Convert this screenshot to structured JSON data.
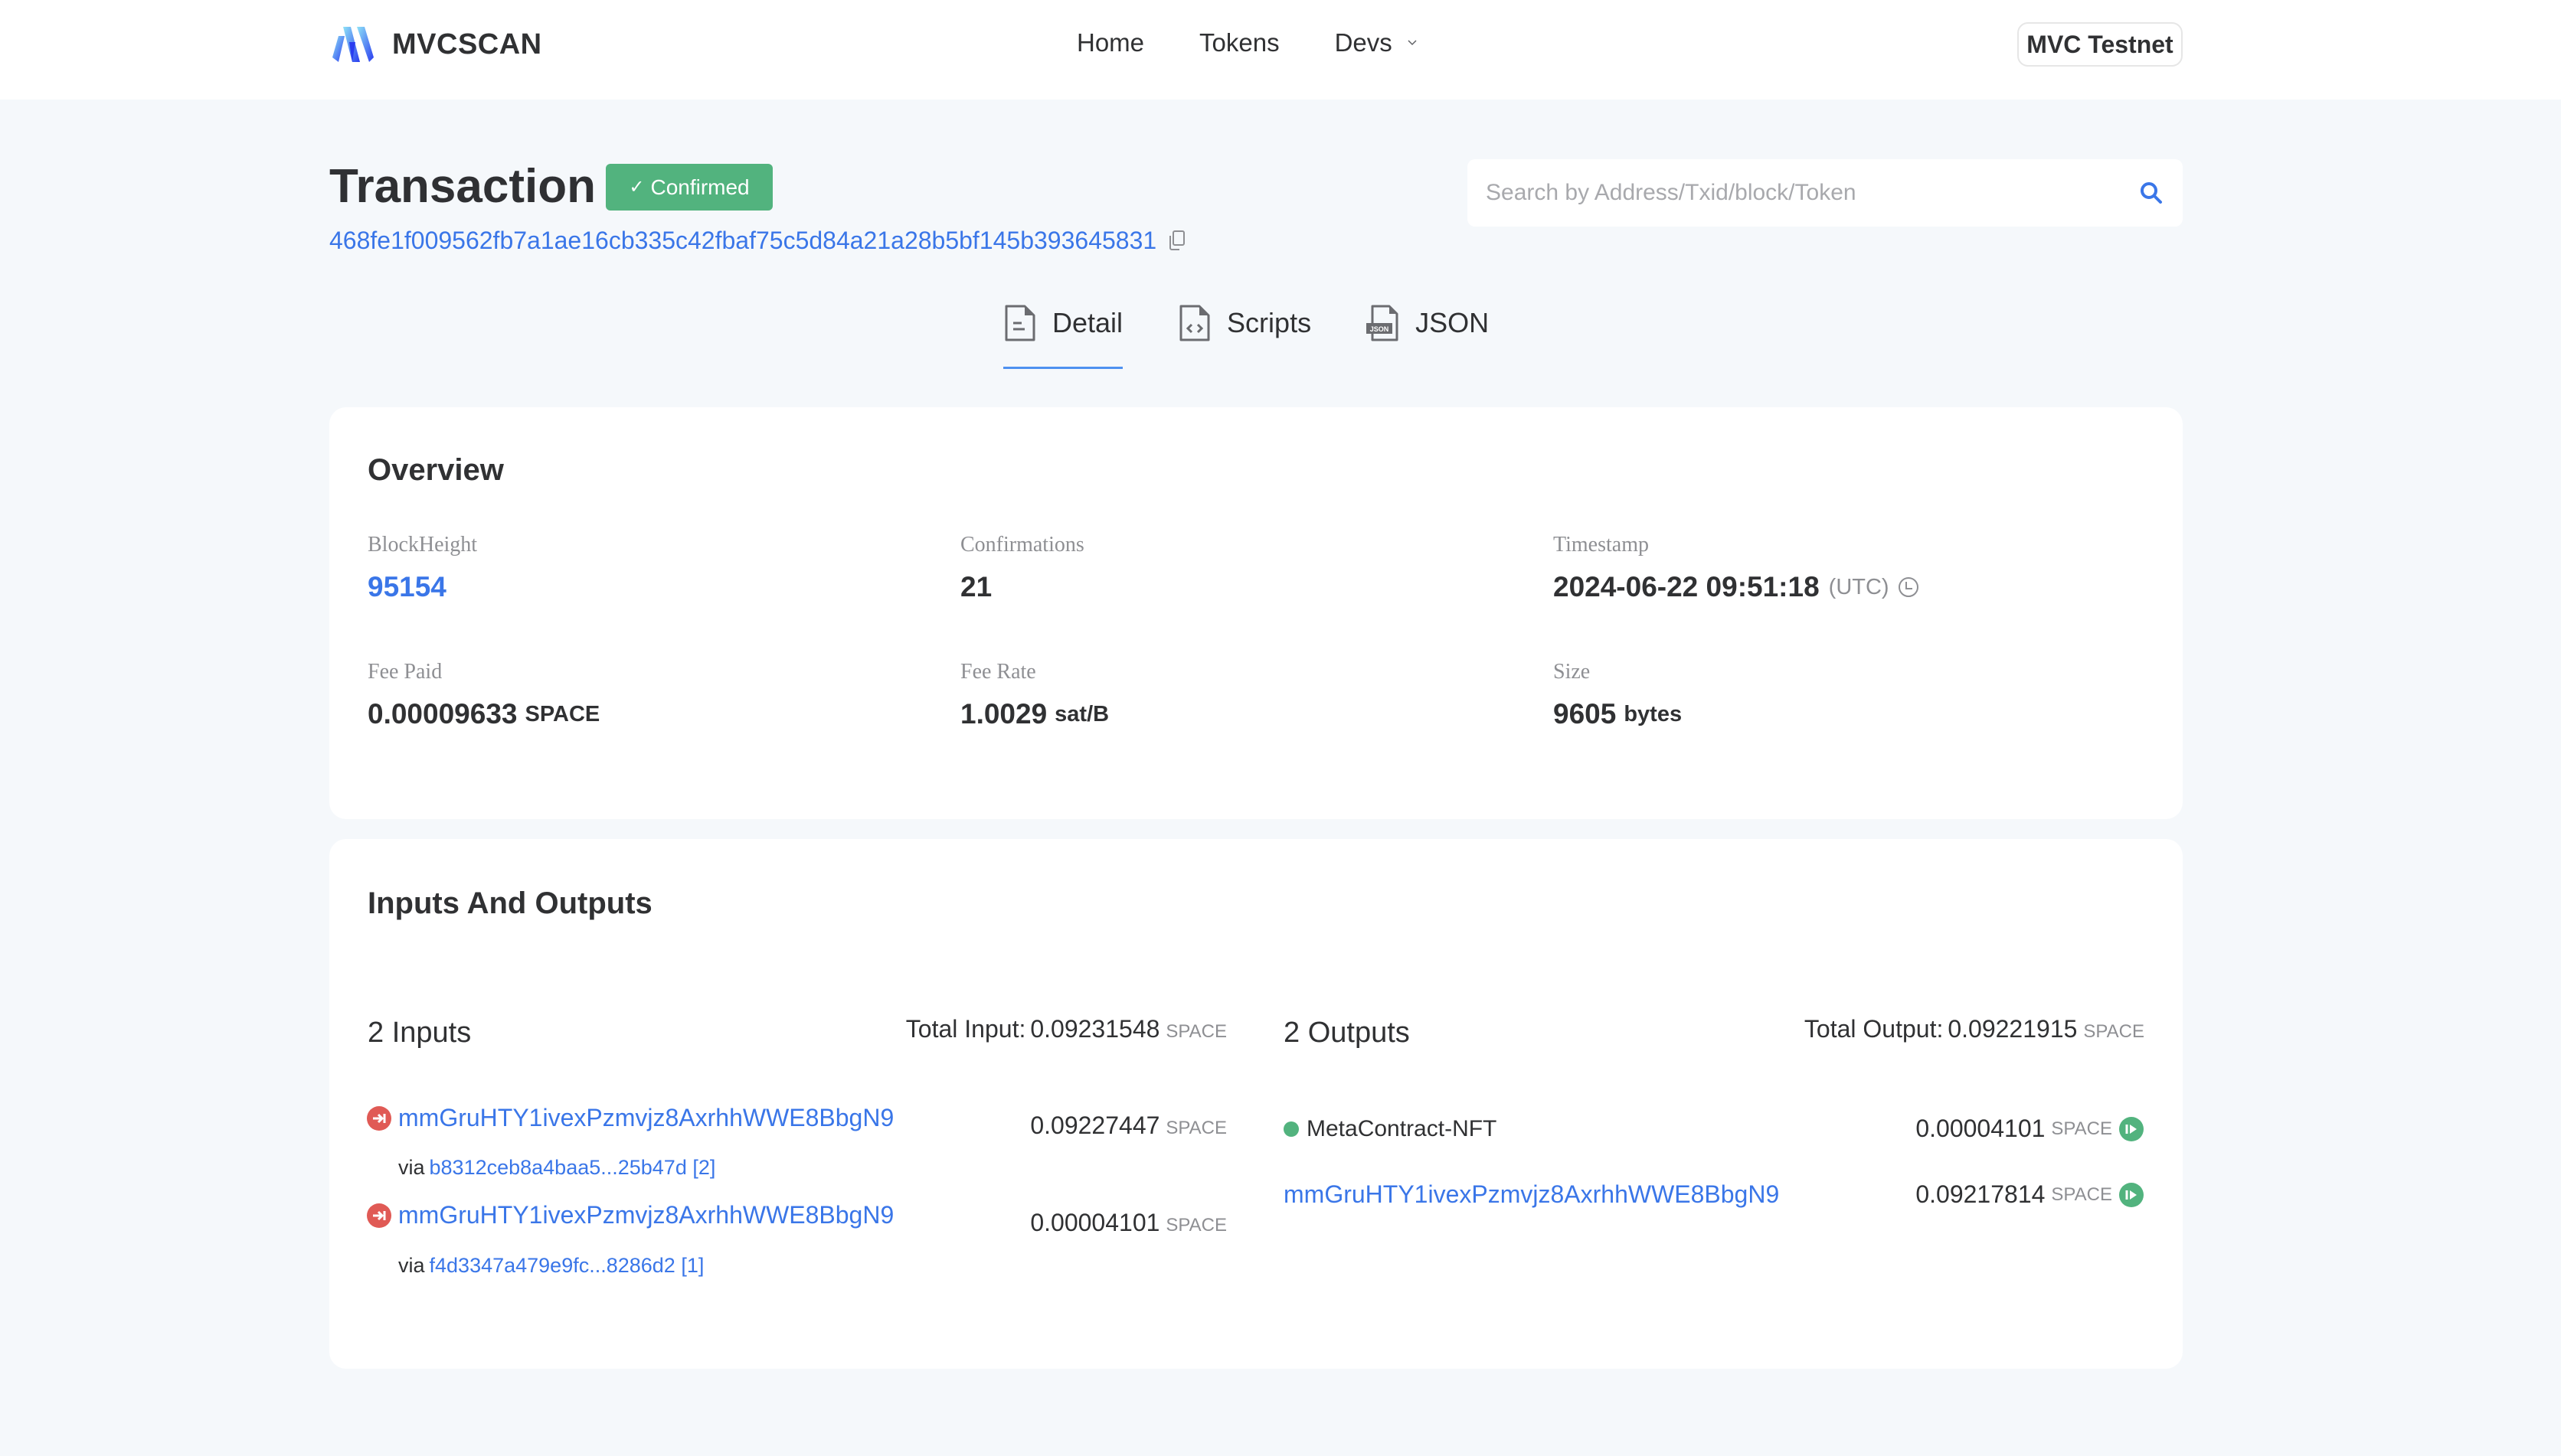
{
  "header": {
    "brand": "MVCSCAN",
    "nav": [
      {
        "label": "Home"
      },
      {
        "label": "Tokens"
      },
      {
        "label": "Devs",
        "has_dropdown": true
      }
    ],
    "network": "MVC Testnet"
  },
  "page": {
    "title": "Transaction",
    "status_badge": "Confirmed",
    "txid": "468fe1f009562fb7a1ae16cb335c42fbaf75c5d84a21a28b5bf145b393645831",
    "search": {
      "placeholder": "Search by Address/Txid/block/Token",
      "value": ""
    }
  },
  "tabs": [
    {
      "label": "Detail",
      "icon": "document-icon",
      "active": true
    },
    {
      "label": "Scripts",
      "icon": "code-file-icon",
      "active": false
    },
    {
      "label": "JSON",
      "icon": "json-file-icon",
      "active": false
    }
  ],
  "overview": {
    "title": "Overview",
    "block_height": {
      "label": "BlockHeight",
      "value": "95154"
    },
    "confirmations": {
      "label": "Confirmations",
      "value": "21"
    },
    "timestamp": {
      "label": "Timestamp",
      "value": "2024-06-22 09:51:18",
      "tz": "(UTC)"
    },
    "fee_paid": {
      "label": "Fee Paid",
      "value": "0.00009633",
      "unit": "SPACE"
    },
    "fee_rate": {
      "label": "Fee Rate",
      "value": "1.0029",
      "unit": "sat/B"
    },
    "size": {
      "label": "Size",
      "value": "9605",
      "unit": "bytes"
    }
  },
  "io": {
    "title": "Inputs And Outputs",
    "inputs": {
      "count_label": "2 Inputs",
      "total_label": "Total Input:",
      "total_value": "0.09231548",
      "unit": "SPACE",
      "items": [
        {
          "address": "mmGruHTY1ivexPzmvjz8AxrhhWWE8BbgN9",
          "via_label": "via",
          "via_tx": "b8312ceb8a4baa5...25b47d [2]",
          "amount": "0.09227447",
          "unit": "SPACE"
        },
        {
          "address": "mmGruHTY1ivexPzmvjz8AxrhhWWE8BbgN9",
          "via_label": "via",
          "via_tx": "f4d3347a479e9fc...8286d2 [1]",
          "amount": "0.00004101",
          "unit": "SPACE"
        }
      ]
    },
    "outputs": {
      "count_label": "2 Outputs",
      "total_label": "Total Output:",
      "total_value": "0.09221915",
      "unit": "SPACE",
      "items": [
        {
          "label": "MetaContract-NFT",
          "type": "token",
          "amount": "0.00004101",
          "unit": "SPACE"
        },
        {
          "label": "mmGruHTY1ivexPzmvjz8AxrhhWWE8BbgN9",
          "type": "address",
          "amount": "0.09217814",
          "unit": "SPACE"
        }
      ]
    }
  },
  "colors": {
    "accent": "#3a76e8",
    "confirmed": "#52b37e",
    "input_icon": "#e05a55",
    "output_icon": "#52b37e",
    "background": "#f5f8fb"
  }
}
